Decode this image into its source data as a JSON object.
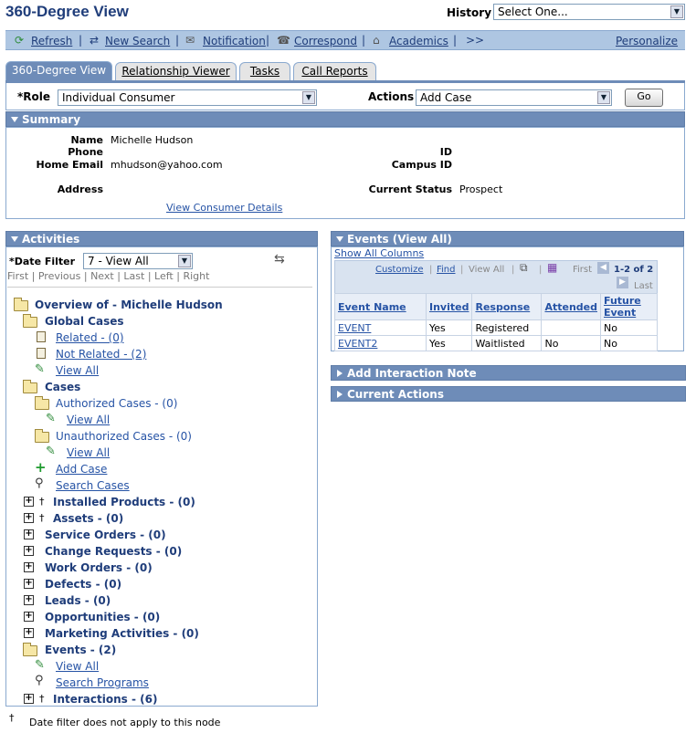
{
  "header": {
    "title": "360-Degree View",
    "history_label": "History",
    "history_value": "Select One..."
  },
  "toolbar": {
    "refresh": "Refresh",
    "new_search": "New Search",
    "notification": "Notification",
    "correspond": "Correspond",
    "academics": "Academics",
    "more": ">>",
    "personalize": "Personalize",
    "sep": "|"
  },
  "tabs": [
    "360-Degree View",
    "Relationship Viewer",
    "Tasks",
    "Call Reports"
  ],
  "role": {
    "label": "*Role",
    "value": "Individual Consumer",
    "actions_label": "Actions",
    "actions_value": "Add Case",
    "go": "Go"
  },
  "summary": {
    "title": "Summary",
    "name_label": "Name",
    "name": "Michelle Hudson",
    "phone_label": "Phone",
    "email_label": "Home Email",
    "email": "mhudson@yahoo.com",
    "address_label": "Address",
    "id_label": "ID",
    "campus_label": "Campus ID",
    "status_label": "Current Status",
    "status": "Prospect",
    "details_link": "View Consumer Details"
  },
  "activities": {
    "title": "Activities",
    "date_filter_label": "*Date Filter",
    "date_filter_value": "7 - View All",
    "nav": [
      "First",
      "Previous",
      "Next",
      "Last",
      "Left",
      "Right"
    ],
    "tree": {
      "root": "Overview of - Michelle Hudson",
      "global_cases": "Global Cases",
      "related": "Related - (0)",
      "not_related": "Not Related - (2)",
      "view_all": "View All",
      "cases": "Cases",
      "authorized": "Authorized Cases - (0)",
      "unauthorized": "Unauthorized Cases - (0)",
      "add_case": "Add Case",
      "search_cases": "Search Cases",
      "installed": "Installed Products - (0)",
      "assets": "Assets - (0)",
      "service_orders": "Service Orders - (0)",
      "change_requests": "Change Requests - (0)",
      "work_orders": "Work Orders - (0)",
      "defects": "Defects - (0)",
      "leads": "Leads - (0)",
      "opportunities": "Opportunities - (0)",
      "marketing": "Marketing Activities - (0)",
      "events": "Events - (2)",
      "search_programs": "Search Programs",
      "interactions": "Interactions - (6)",
      "dagger": "†"
    }
  },
  "events": {
    "title": "Events (View All)",
    "show_all": "Show All Columns",
    "customize": "Customize",
    "find": "Find",
    "view_all": "View All",
    "first": "First",
    "range": "1-2 of 2",
    "last": "Last",
    "columns": [
      "Event Name",
      "Invited",
      "Response",
      "Attended",
      "Future Event"
    ],
    "rows": [
      [
        "EVENT",
        "Yes",
        "Registered",
        "",
        "No"
      ],
      [
        "EVENT2",
        "Yes",
        "Waitlisted",
        "No",
        "No"
      ]
    ]
  },
  "sections": {
    "interaction_note": "Add Interaction Note",
    "current_actions": "Current Actions"
  },
  "footnote": {
    "mark": "†",
    "text": "Date filter does not apply to this node"
  }
}
